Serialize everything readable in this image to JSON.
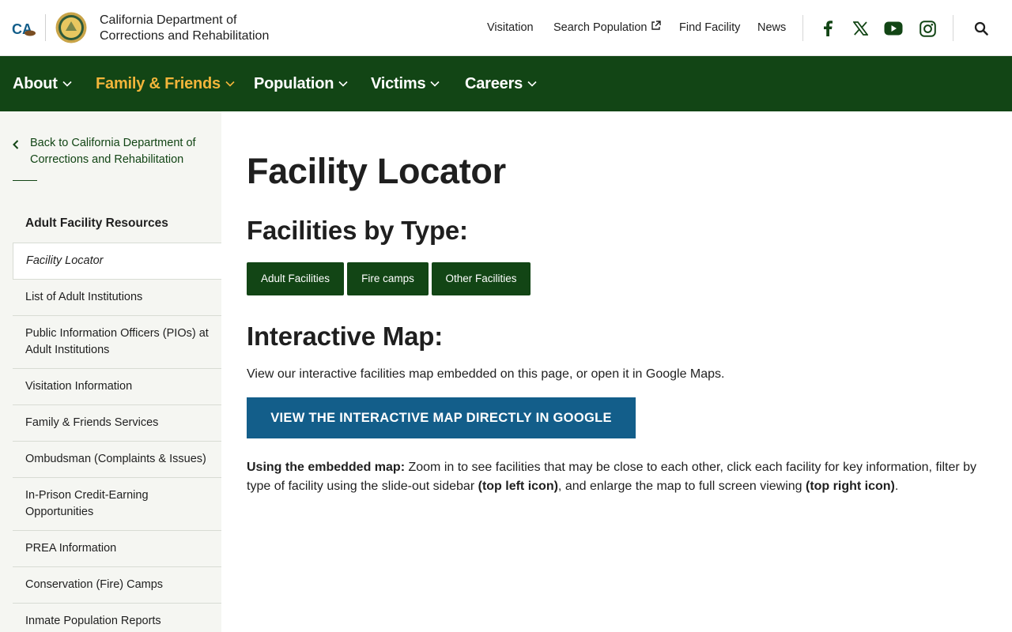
{
  "header": {
    "dept_name": "California Department of Corrections and Rehabilitation",
    "ca_logo_text": "CA",
    "util_links": [
      "Visitation",
      "Search Population",
      "Find Facility",
      "News"
    ]
  },
  "social": [
    "facebook-icon",
    "x-icon",
    "youtube-icon",
    "instagram-icon"
  ],
  "nav": {
    "items": [
      "About",
      "Family & Friends",
      "Population",
      "Victims",
      "Careers"
    ],
    "active_index": 1
  },
  "sidebar": {
    "back_label": "Back to California Department of Corrections and Rehabilitation",
    "heading": "Adult Facility Resources",
    "items": [
      "Facility Locator",
      "List of Adult Institutions",
      "Public Information Officers (PIOs) at Adult Institutions",
      "Visitation Information",
      "Family & Friends Services",
      "Ombudsman (Complaints & Issues)",
      "In-Prison Credit-Earning Opportunities",
      "PREA Information",
      "Conservation (Fire) Camps",
      "Inmate Population Reports"
    ]
  },
  "main": {
    "title": "Facility Locator",
    "types_heading": "Facilities by Type:",
    "type_buttons": [
      "Adult Facilities",
      "Fire camps",
      "Other Facilities"
    ],
    "map_heading": "Interactive Map:",
    "map_desc": "View our interactive facilities map embedded on this page, or open it in Google Maps.",
    "google_button": "VIEW THE INTERACTIVE MAP DIRECTLY IN GOOGLE",
    "usage_lead": "Using the embedded map:",
    "usage_text_1": " Zoom in to see facilities that may be close to each other, click each facility for key information, filter by type of facility using the slide-out sidebar ",
    "usage_bold_1": "(top left icon)",
    "usage_text_2": ", and enlarge the map to full screen viewing ",
    "usage_bold_2": "(top right icon)",
    "usage_text_3": "."
  },
  "colors": {
    "nav_green": "#124515",
    "active_gold": "#f2b53a",
    "map_button_blue": "#135e8a",
    "sidebar_bg": "#f5f6f2"
  }
}
